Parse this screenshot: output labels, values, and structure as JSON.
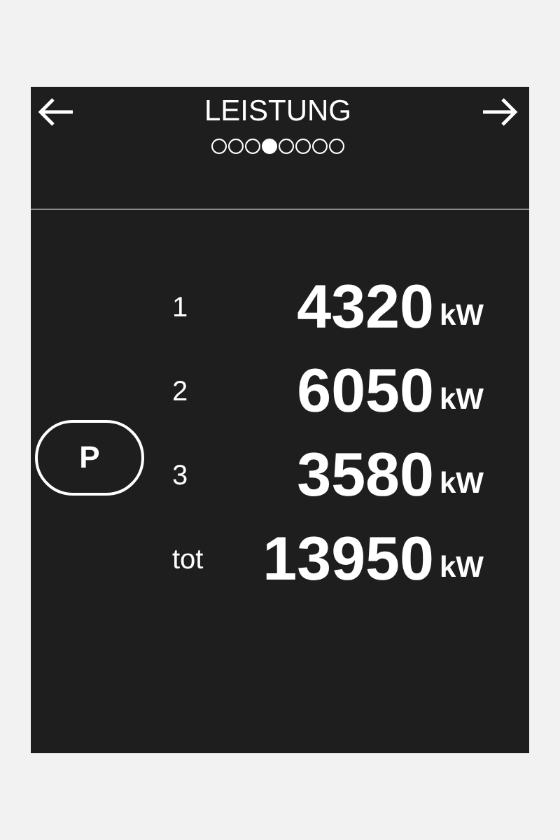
{
  "header": {
    "title": "LEISTUNG"
  },
  "page_dots": [
    {
      "selected": false
    },
    {
      "selected": false
    },
    {
      "selected": false
    },
    {
      "selected": true
    },
    {
      "selected": false
    },
    {
      "selected": false
    },
    {
      "selected": false
    },
    {
      "selected": false
    }
  ],
  "mode_button": {
    "label": "P"
  },
  "rows": [
    {
      "label": "1",
      "value": "4320",
      "unit": "kW"
    },
    {
      "label": "2",
      "value": "6050",
      "unit": "kW"
    },
    {
      "label": "3",
      "value": "3580",
      "unit": "kW"
    },
    {
      "label": "tot",
      "value": "13950",
      "unit": "kW"
    }
  ]
}
